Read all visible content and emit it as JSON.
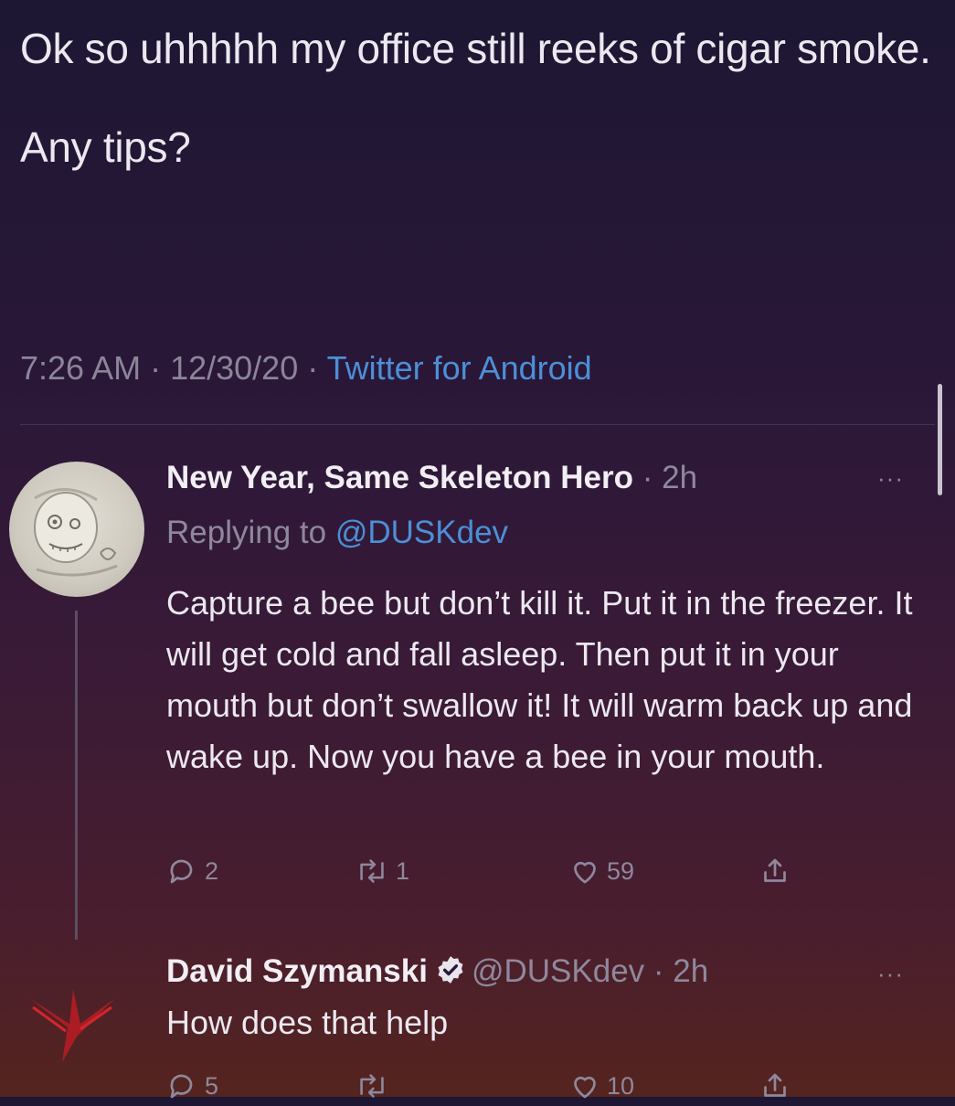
{
  "tweet": {
    "line1": "Ok so uhhhhh my office still reeks of cigar smoke.",
    "line2": "Any tips?",
    "time": "7:26 AM",
    "date": "12/30/20",
    "source": "Twitter for Android",
    "sep": " · "
  },
  "reply1": {
    "name": "New Year, Same Skeleton Hero",
    "age": "2h",
    "replying_prefix": "Replying to ",
    "replying_handle": "@DUSKdev",
    "body": "Capture a bee but don’t kill it. Put it in the freezer. It will get cold and fall asleep. Then put it in your mouth but don’t swallow it! It will warm back up and wake up. Now you have a bee in your mouth.",
    "reply_count": "2",
    "retweet_count": "1",
    "like_count": "59",
    "more": "···",
    "avatar_icon": "skeleton-avatar-icon"
  },
  "reply2": {
    "name": "David Szymanski",
    "handle": "@DUSKdev",
    "age": "2h",
    "body": "How does that help",
    "reply_count": "5",
    "like_count": "10",
    "more": "···",
    "avatar_icon": "dusk-logo-icon"
  },
  "colors": {
    "link": "#4c8fd6",
    "muted": "#8f889c",
    "text": "#ece8f0"
  }
}
